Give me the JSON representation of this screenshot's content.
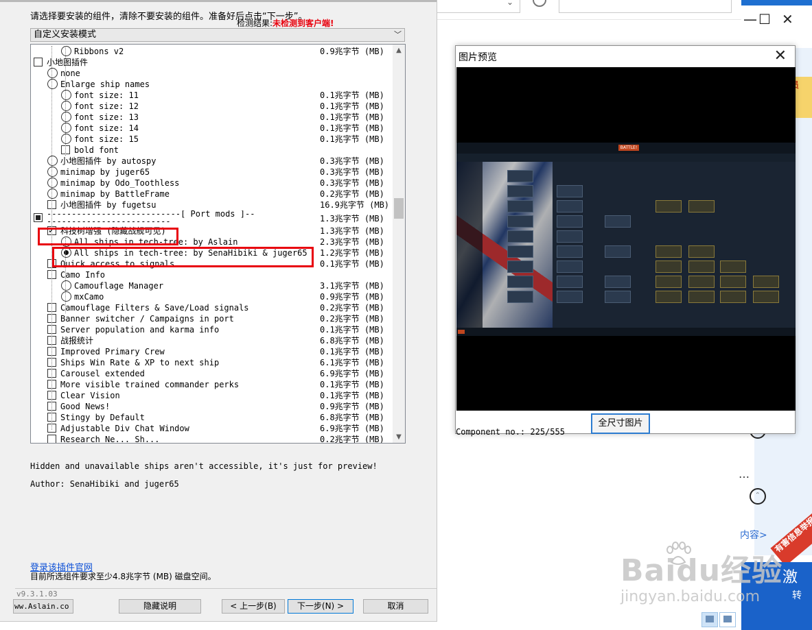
{
  "installer": {
    "instruction": "请选择要安装的组件，清除不要安装的组件。准备好后点击“下一步”。",
    "detect_label": "检测结果:",
    "detect_value": "未检测到客户端!",
    "mode": "自定义安装模式",
    "components": [
      {
        "label": "Ribbons v2",
        "size": "0.9兆字节 (MB)",
        "ctl": "radio",
        "checked": false,
        "indent": 2
      },
      {
        "label": "小地图插件",
        "size": "",
        "ctl": "checkbox",
        "checked": false,
        "indent": 0
      },
      {
        "label": "none",
        "size": "",
        "ctl": "radio",
        "checked": false,
        "indent": 1
      },
      {
        "label": "Enlarge ship names",
        "size": "",
        "ctl": "radio",
        "checked": false,
        "indent": 1
      },
      {
        "label": "font size: 11",
        "size": "0.1兆字节 (MB)",
        "ctl": "radio",
        "checked": false,
        "indent": 2
      },
      {
        "label": "font size: 12",
        "size": "0.1兆字节 (MB)",
        "ctl": "radio",
        "checked": false,
        "indent": 2
      },
      {
        "label": "font size: 13",
        "size": "0.1兆字节 (MB)",
        "ctl": "radio",
        "checked": false,
        "indent": 2
      },
      {
        "label": "font size: 14",
        "size": "0.1兆字节 (MB)",
        "ctl": "radio",
        "checked": false,
        "indent": 2
      },
      {
        "label": "font size: 15",
        "size": "0.1兆字节 (MB)",
        "ctl": "radio",
        "checked": false,
        "indent": 2
      },
      {
        "label": "bold font",
        "size": "",
        "ctl": "checkbox",
        "checked": false,
        "indent": 2
      },
      {
        "label": "小地图插件 by autospy",
        "size": "0.3兆字节 (MB)",
        "ctl": "radio",
        "checked": false,
        "indent": 1
      },
      {
        "label": "minimap by juger65",
        "size": "0.3兆字节 (MB)",
        "ctl": "radio",
        "checked": false,
        "indent": 1
      },
      {
        "label": "minimap by Odo_Toothless",
        "size": "0.3兆字节 (MB)",
        "ctl": "radio",
        "checked": false,
        "indent": 1
      },
      {
        "label": "minimap by BattleFrame",
        "size": "0.2兆字节 (MB)",
        "ctl": "radio",
        "checked": false,
        "indent": 1
      },
      {
        "label": "小地图插件 by fugetsu",
        "size": "16.9兆字节 (MB)",
        "ctl": "checkbox",
        "checked": false,
        "indent": 1
      },
      {
        "label": "---------------------------[ Port mods ]---------------------------",
        "size": "1.3兆字节 (MB)",
        "ctl": "checkbox-partial",
        "checked": true,
        "indent": 0,
        "tall": true
      },
      {
        "label": "科技树增强 (隐藏战舰可见)",
        "size": "1.3兆字节 (MB)",
        "ctl": "checkbox",
        "checked": true,
        "indent": 1
      },
      {
        "label": "All ships in tech-tree: by Aslain",
        "size": "2.3兆字节 (MB)",
        "ctl": "radio",
        "checked": false,
        "indent": 2
      },
      {
        "label": "All ships in tech-tree: by SenaHibiki & juger65",
        "size": "1.2兆字节 (MB)",
        "ctl": "radio",
        "checked": true,
        "indent": 2
      },
      {
        "label": "Quick access to signals",
        "size": "0.1兆字节 (MB)",
        "ctl": "checkbox",
        "checked": false,
        "indent": 1
      },
      {
        "label": "Camo Info",
        "size": "",
        "ctl": "checkbox",
        "checked": false,
        "indent": 1
      },
      {
        "label": "Camouflage Manager",
        "size": "3.1兆字节 (MB)",
        "ctl": "radio",
        "checked": false,
        "indent": 2
      },
      {
        "label": "mxCamo",
        "size": "0.9兆字节 (MB)",
        "ctl": "radio",
        "checked": false,
        "indent": 2
      },
      {
        "label": "Camouflage Filters & Save/Load signals",
        "size": "0.2兆字节 (MB)",
        "ctl": "checkbox",
        "checked": false,
        "indent": 1
      },
      {
        "label": "Banner switcher / Campaigns in port",
        "size": "0.2兆字节 (MB)",
        "ctl": "checkbox",
        "checked": false,
        "indent": 1
      },
      {
        "label": "Server population and karma info",
        "size": "0.1兆字节 (MB)",
        "ctl": "checkbox",
        "checked": false,
        "indent": 1
      },
      {
        "label": "战报统计",
        "size": "6.8兆字节 (MB)",
        "ctl": "checkbox",
        "checked": false,
        "indent": 1
      },
      {
        "label": "Improved Primary Crew",
        "size": "0.1兆字节 (MB)",
        "ctl": "checkbox",
        "checked": false,
        "indent": 1
      },
      {
        "label": "Ships Win Rate & XP to next ship",
        "size": "6.1兆字节 (MB)",
        "ctl": "checkbox",
        "checked": false,
        "indent": 1
      },
      {
        "label": "Carousel extended",
        "size": "6.9兆字节 (MB)",
        "ctl": "checkbox",
        "checked": false,
        "indent": 1
      },
      {
        "label": "More visible trained commander perks",
        "size": "0.1兆字节 (MB)",
        "ctl": "checkbox",
        "checked": false,
        "indent": 1
      },
      {
        "label": "Clear Vision",
        "size": "0.1兆字节 (MB)",
        "ctl": "checkbox",
        "checked": false,
        "indent": 1
      },
      {
        "label": "Good News!",
        "size": "0.9兆字节 (MB)",
        "ctl": "checkbox",
        "checked": false,
        "indent": 1
      },
      {
        "label": "Stingy by Default",
        "size": "6.8兆字节 (MB)",
        "ctl": "checkbox",
        "checked": false,
        "indent": 1
      },
      {
        "label": "Adjustable Div Chat Window",
        "size": "6.9兆字节 (MB)",
        "ctl": "checkbox",
        "checked": false,
        "indent": 1
      },
      {
        "label": "Research Ne... Sh...",
        "size": "0.2兆字节 (MB)",
        "ctl": "checkbox",
        "checked": false,
        "indent": 1
      }
    ],
    "desc_line1": "Hidden and unavailable ships aren't accessible, it's just for preview!",
    "desc_line2": "Author: SenaHibiki and juger65",
    "site_link": "登录该插件官网",
    "space_required": "目前所选组件要求至少4.8兆字节 (MB) 磁盘空间。",
    "version": "v9.3.1.03",
    "site_button": "ww.Aslain.co",
    "buttons": {
      "hide_desc": "隐藏说明",
      "back": "< 上一步(B)",
      "next": "下一步(N) >",
      "cancel": "取消"
    }
  },
  "preview": {
    "title": "图片预览",
    "close": "✕",
    "full_size_button": "全尺寸图片",
    "component_no": "Component no.: 225/555",
    "game_battle": "BATTLE!"
  },
  "browser": {
    "badge": "费员",
    "content_link": "内容>",
    "report_badge": "有害信息举报",
    "ad_text_1": "激",
    "ad_text_2": "转",
    "watermark_logo": "Baidu经验",
    "watermark_url": "jingyan.baidu.com",
    "ellipsis": "…"
  },
  "colors": {
    "accent_red": "#e8000d",
    "link_blue": "#0b4fd6",
    "focus_blue": "#0078d7"
  }
}
